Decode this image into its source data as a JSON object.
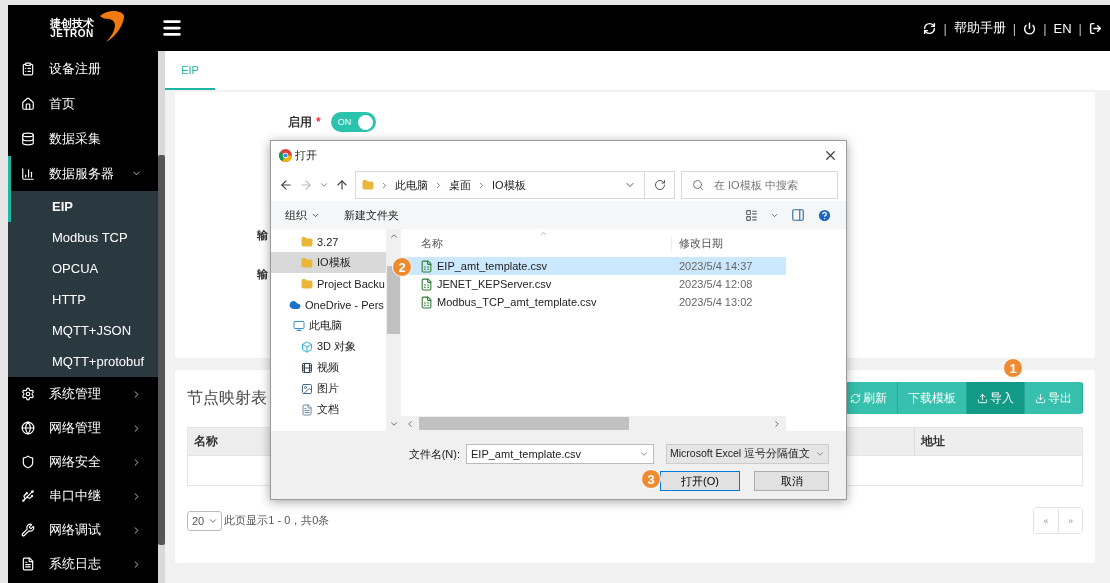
{
  "sidebar": {
    "logo": {
      "name": "捷创技术",
      "brand": "JETRON"
    },
    "items": [
      {
        "label": "设备注册",
        "kind": "link"
      },
      {
        "label": "首页",
        "kind": "link"
      },
      {
        "label": "数据采集",
        "kind": "link"
      },
      {
        "label": "数据服务器",
        "kind": "group",
        "expanded": true,
        "children": [
          {
            "label": "EIP",
            "selected": true
          },
          {
            "label": "Modbus TCP",
            "selected": false
          },
          {
            "label": "OPCUA",
            "selected": false
          },
          {
            "label": "HTTP",
            "selected": false
          },
          {
            "label": "MQTT+JSON",
            "selected": false
          },
          {
            "label": "MQTT+protobuf",
            "selected": false
          }
        ]
      },
      {
        "label": "系统管理",
        "kind": "group",
        "expanded": false
      },
      {
        "label": "网络管理",
        "kind": "group",
        "expanded": false
      },
      {
        "label": "网络安全",
        "kind": "group",
        "expanded": false
      },
      {
        "label": "串口中继",
        "kind": "group",
        "expanded": false
      },
      {
        "label": "网络调试",
        "kind": "group",
        "expanded": false
      },
      {
        "label": "系统日志",
        "kind": "group",
        "expanded": false
      }
    ]
  },
  "header": {
    "items": [
      {
        "kind": "icon"
      },
      {
        "kind": "separator",
        "text": "|"
      },
      {
        "kind": "link",
        "text": "帮助手册"
      },
      {
        "kind": "separator",
        "text": "|"
      },
      {
        "kind": "icon"
      },
      {
        "kind": "separator",
        "text": "|"
      },
      {
        "kind": "link",
        "text": "EN"
      },
      {
        "kind": "separator",
        "text": "|"
      },
      {
        "kind": "icon"
      }
    ]
  },
  "tabs": [
    {
      "label": "EIP",
      "selected": true
    }
  ],
  "settings": {
    "enable": {
      "label": "启用",
      "required_mark": "*",
      "on": true,
      "text": "ON"
    },
    "covered_labels": [
      "输",
      "输"
    ]
  },
  "node_table": {
    "title": "节点映射表",
    "buttons": [
      {
        "label": "刷新",
        "highlighted": false
      },
      {
        "label": "下载模板",
        "highlighted": false
      },
      {
        "label": "导入",
        "highlighted": true
      },
      {
        "label": "导出",
        "highlighted": false
      }
    ],
    "columns": [
      "名称",
      "地址"
    ],
    "page_size": "20",
    "summary": "此页显示1 - 0，共0条",
    "pager": [
      "«",
      "»"
    ]
  },
  "dialog": {
    "title": "打开",
    "path": [
      "此电脑",
      "桌面",
      "IO模板"
    ],
    "search_placeholder": "在 IO模板 中搜索",
    "toolbar": [
      {
        "label": "组织",
        "kind": "menu"
      },
      {
        "label": "新建文件夹",
        "kind": "button"
      }
    ],
    "nav": [
      {
        "label": "3.27",
        "kind": "folder",
        "selected": false
      },
      {
        "label": "IO模板",
        "kind": "folder",
        "selected": true
      },
      {
        "label": "Project Backu",
        "kind": "folder",
        "selected": false
      },
      {
        "label": "OneDrive - Pers",
        "kind": "cloud",
        "selected": false
      },
      {
        "label": "此电脑",
        "kind": "computer",
        "selected": false,
        "children": [
          {
            "label": "3D 对象",
            "kind": "objects",
            "selected": false
          },
          {
            "label": "视频",
            "kind": "videos",
            "selected": false
          },
          {
            "label": "图片",
            "kind": "pictures",
            "selected": false
          },
          {
            "label": "文档",
            "kind": "documents",
            "selected": false
          }
        ]
      }
    ],
    "columns": [
      "名称",
      "修改日期"
    ],
    "files": [
      {
        "name": "EIP_amt_template.csv",
        "date": "2023/5/4 14:37",
        "selected": true
      },
      {
        "name": "JENET_KEPServer.csv",
        "date": "2023/5/4 12:08",
        "selected": false
      },
      {
        "name": "Modbus_TCP_amt_template.csv",
        "date": "2023/5/4 13:02",
        "selected": false
      }
    ],
    "filename_label": "文件名(N):",
    "filename": "EIP_amt_template.csv",
    "filetype": "Microsoft Excel 逗号分隔值文",
    "buttons": [
      {
        "label": "打开(O)",
        "focused": true
      },
      {
        "label": "取消",
        "focused": false
      }
    ]
  },
  "annotations": [
    "1",
    "2",
    "3"
  ]
}
